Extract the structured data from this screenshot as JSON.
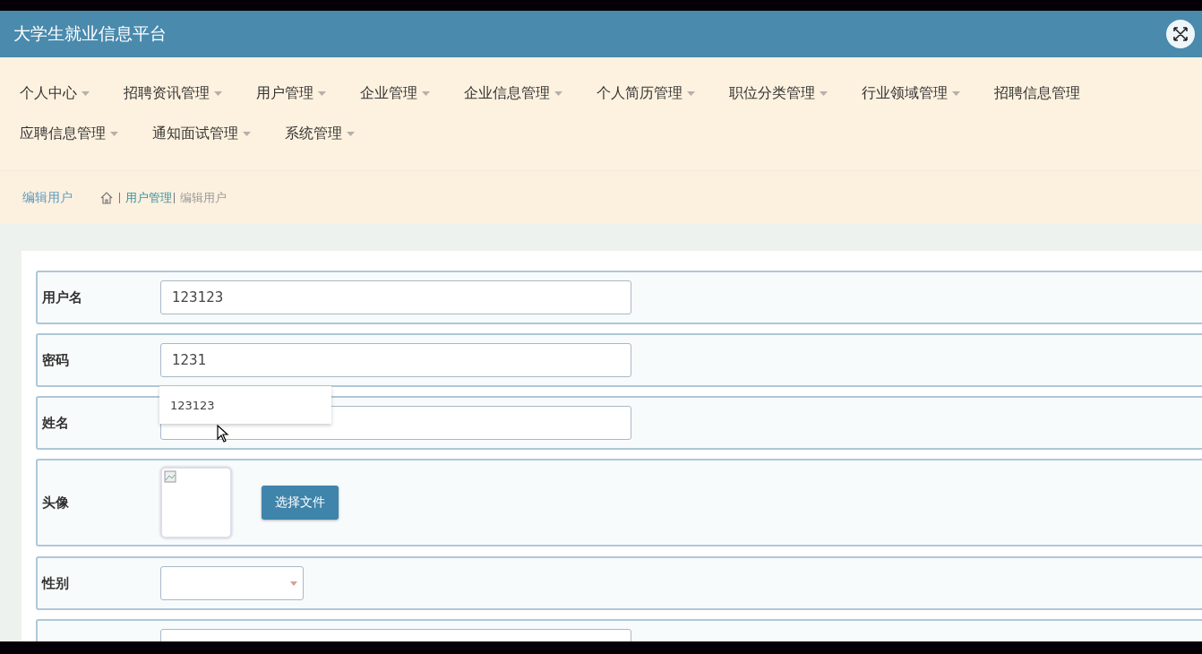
{
  "window": {
    "title": "大学生就业信息平台"
  },
  "menu_rows": [
    [
      {
        "label": "个人中心",
        "caret": true
      },
      {
        "label": "招聘资讯管理",
        "caret": true
      },
      {
        "label": "用户管理",
        "caret": true
      },
      {
        "label": "企业管理",
        "caret": true
      },
      {
        "label": "企业信息管理",
        "caret": true
      },
      {
        "label": "个人简历管理",
        "caret": true
      },
      {
        "label": "职位分类管理",
        "caret": true
      },
      {
        "label": "行业领域管理",
        "caret": true
      },
      {
        "label": "招聘信息管理",
        "caret": false
      }
    ],
    [
      {
        "label": "应聘信息管理",
        "caret": true
      },
      {
        "label": "通知面试管理",
        "caret": true
      },
      {
        "label": "系统管理",
        "caret": true
      }
    ]
  ],
  "breadcrumb": {
    "page_title": "编辑用户",
    "path": [
      {
        "label": "用户管理",
        "kind": "link"
      },
      {
        "label": "编辑用户",
        "kind": "current"
      }
    ]
  },
  "form": {
    "fields": [
      {
        "label": "用户名",
        "kind": "text",
        "value": "123123"
      },
      {
        "label": "密码",
        "kind": "text",
        "value": "1231",
        "suggestions": [
          "123123"
        ]
      },
      {
        "label": "姓名",
        "kind": "text"
      },
      {
        "label": "头像",
        "kind": "image",
        "button": "选择文件"
      },
      {
        "label": "性别",
        "kind": "select"
      },
      {
        "kind": "text"
      }
    ]
  }
}
